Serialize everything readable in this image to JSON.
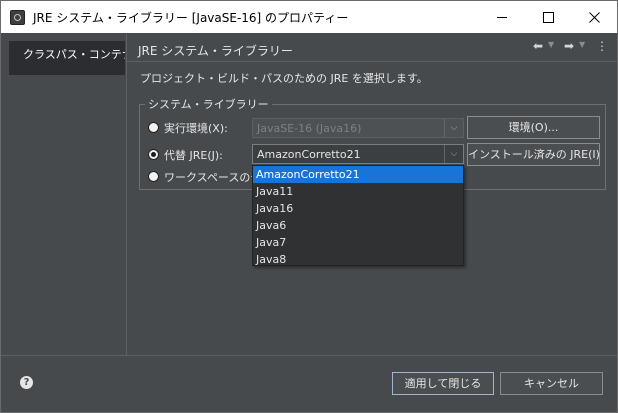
{
  "window": {
    "title": "JRE システム・ライブラリー [JavaSE-16] のプロパティー",
    "icon": "eclipse-icon"
  },
  "sidebar": {
    "items": [
      {
        "label": "クラスパス・コンテナー",
        "selected": true
      }
    ]
  },
  "page": {
    "title": "JRE システム・ライブラリー",
    "description": "プロジェクト・ビルド・パスのための JRE を選択します。"
  },
  "group": {
    "label": "システム・ライブラリー",
    "execution_env": {
      "label": "実行環境(X):",
      "value": "JavaSE-16 (Java16)",
      "checked": false,
      "button": "環境(O)..."
    },
    "alternate_jre": {
      "label": "代替 JRE(J):",
      "value": "AmazonCorretto21",
      "checked": true,
      "button": "インストール済みの JRE(I)..."
    },
    "workspace_default": {
      "label": "ワークスペースのデ",
      "checked": false
    }
  },
  "dropdown": {
    "options": [
      "AmazonCorretto21",
      "Java11",
      "Java16",
      "Java6",
      "Java7",
      "Java8"
    ],
    "selected_index": 0
  },
  "footer": {
    "apply_close": "適用して閉じる",
    "cancel": "キャンセル",
    "help": "?"
  },
  "colors": {
    "background": "#474a4d",
    "selection": "#1874d6"
  }
}
